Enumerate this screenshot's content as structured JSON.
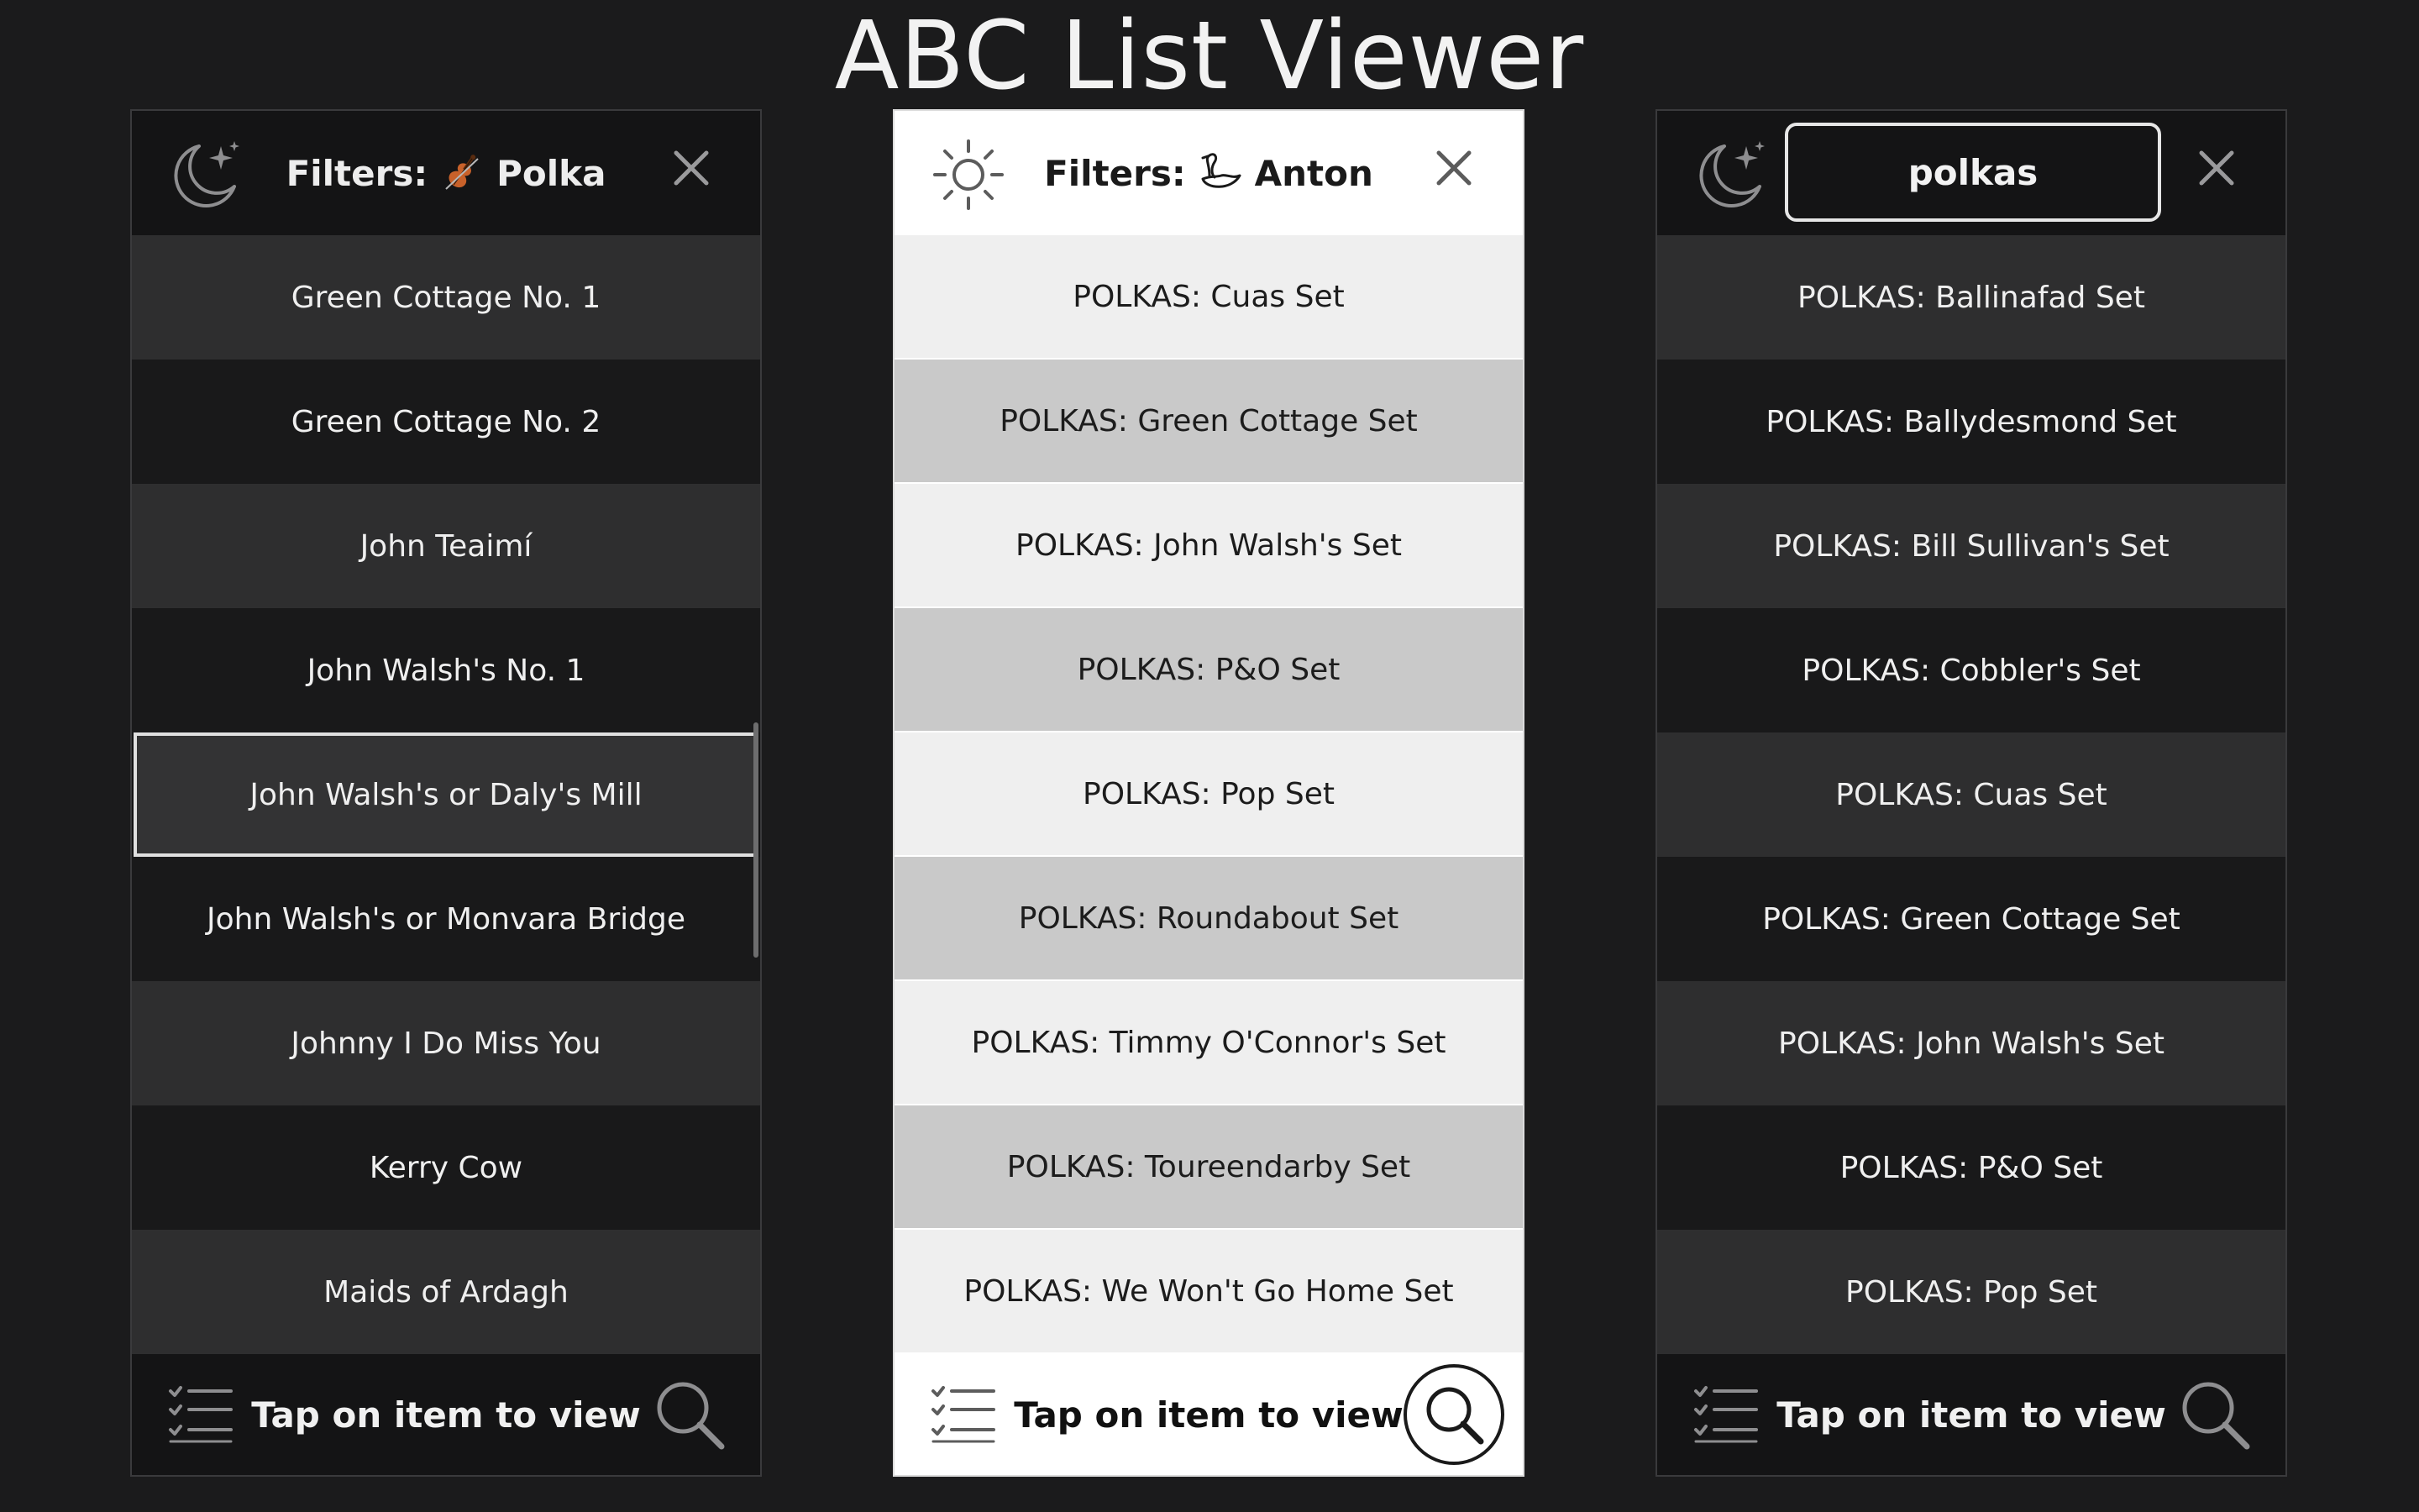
{
  "app_title": "ABC List Viewer",
  "colors": {
    "background": "#1b1b1c",
    "dark_panel": "#141415",
    "dark_row_alt": "#2e2e2f",
    "light_row": "#efefef",
    "light_row_alt": "#c9c9c9",
    "violin_icon": "#c8612a"
  },
  "panels": [
    {
      "theme": "dark",
      "theme_icon": "moon-stars-icon",
      "header": {
        "filter_prefix": "Filters:",
        "filter_icon": "violin-icon",
        "filter_value": "Polka"
      },
      "items": [
        "Green Cottage No. 1",
        "Green Cottage No. 2",
        "John Teaimí",
        "John Walsh's No. 1",
        "John Walsh's or Daly's Mill",
        "John Walsh's or Monvara Bridge",
        "Johnny I Do Miss You",
        "Kerry Cow",
        "Maids of Ardagh"
      ],
      "selected_index": 4,
      "footer_text": "Tap on item to view"
    },
    {
      "theme": "light",
      "theme_icon": "sun-icon",
      "header": {
        "filter_prefix": "Filters:",
        "filter_icon": "swan-icon",
        "filter_value": "Anton"
      },
      "items": [
        "POLKAS: Cuas Set",
        "POLKAS: Green Cottage Set",
        "POLKAS: John Walsh's Set",
        "POLKAS: P&O Set",
        "POLKAS: Pop Set",
        "POLKAS: Roundabout Set",
        "POLKAS: Timmy O'Connor's Set",
        "POLKAS: Toureendarby Set",
        "POLKAS: We Won't Go Home Set"
      ],
      "footer_text": "Tap on item to view"
    },
    {
      "theme": "dark",
      "theme_icon": "moon-stars-icon",
      "header": {
        "search_value": "polkas"
      },
      "items": [
        "POLKAS: Ballinafad Set",
        "POLKAS: Ballydesmond Set",
        "POLKAS: Bill Sullivan's Set",
        "POLKAS: Cobbler's Set",
        "POLKAS: Cuas Set",
        "POLKAS: Green Cottage Set",
        "POLKAS: John Walsh's Set",
        "POLKAS: P&O Set",
        "POLKAS: Pop Set"
      ],
      "footer_text": "Tap on item to view"
    }
  ]
}
